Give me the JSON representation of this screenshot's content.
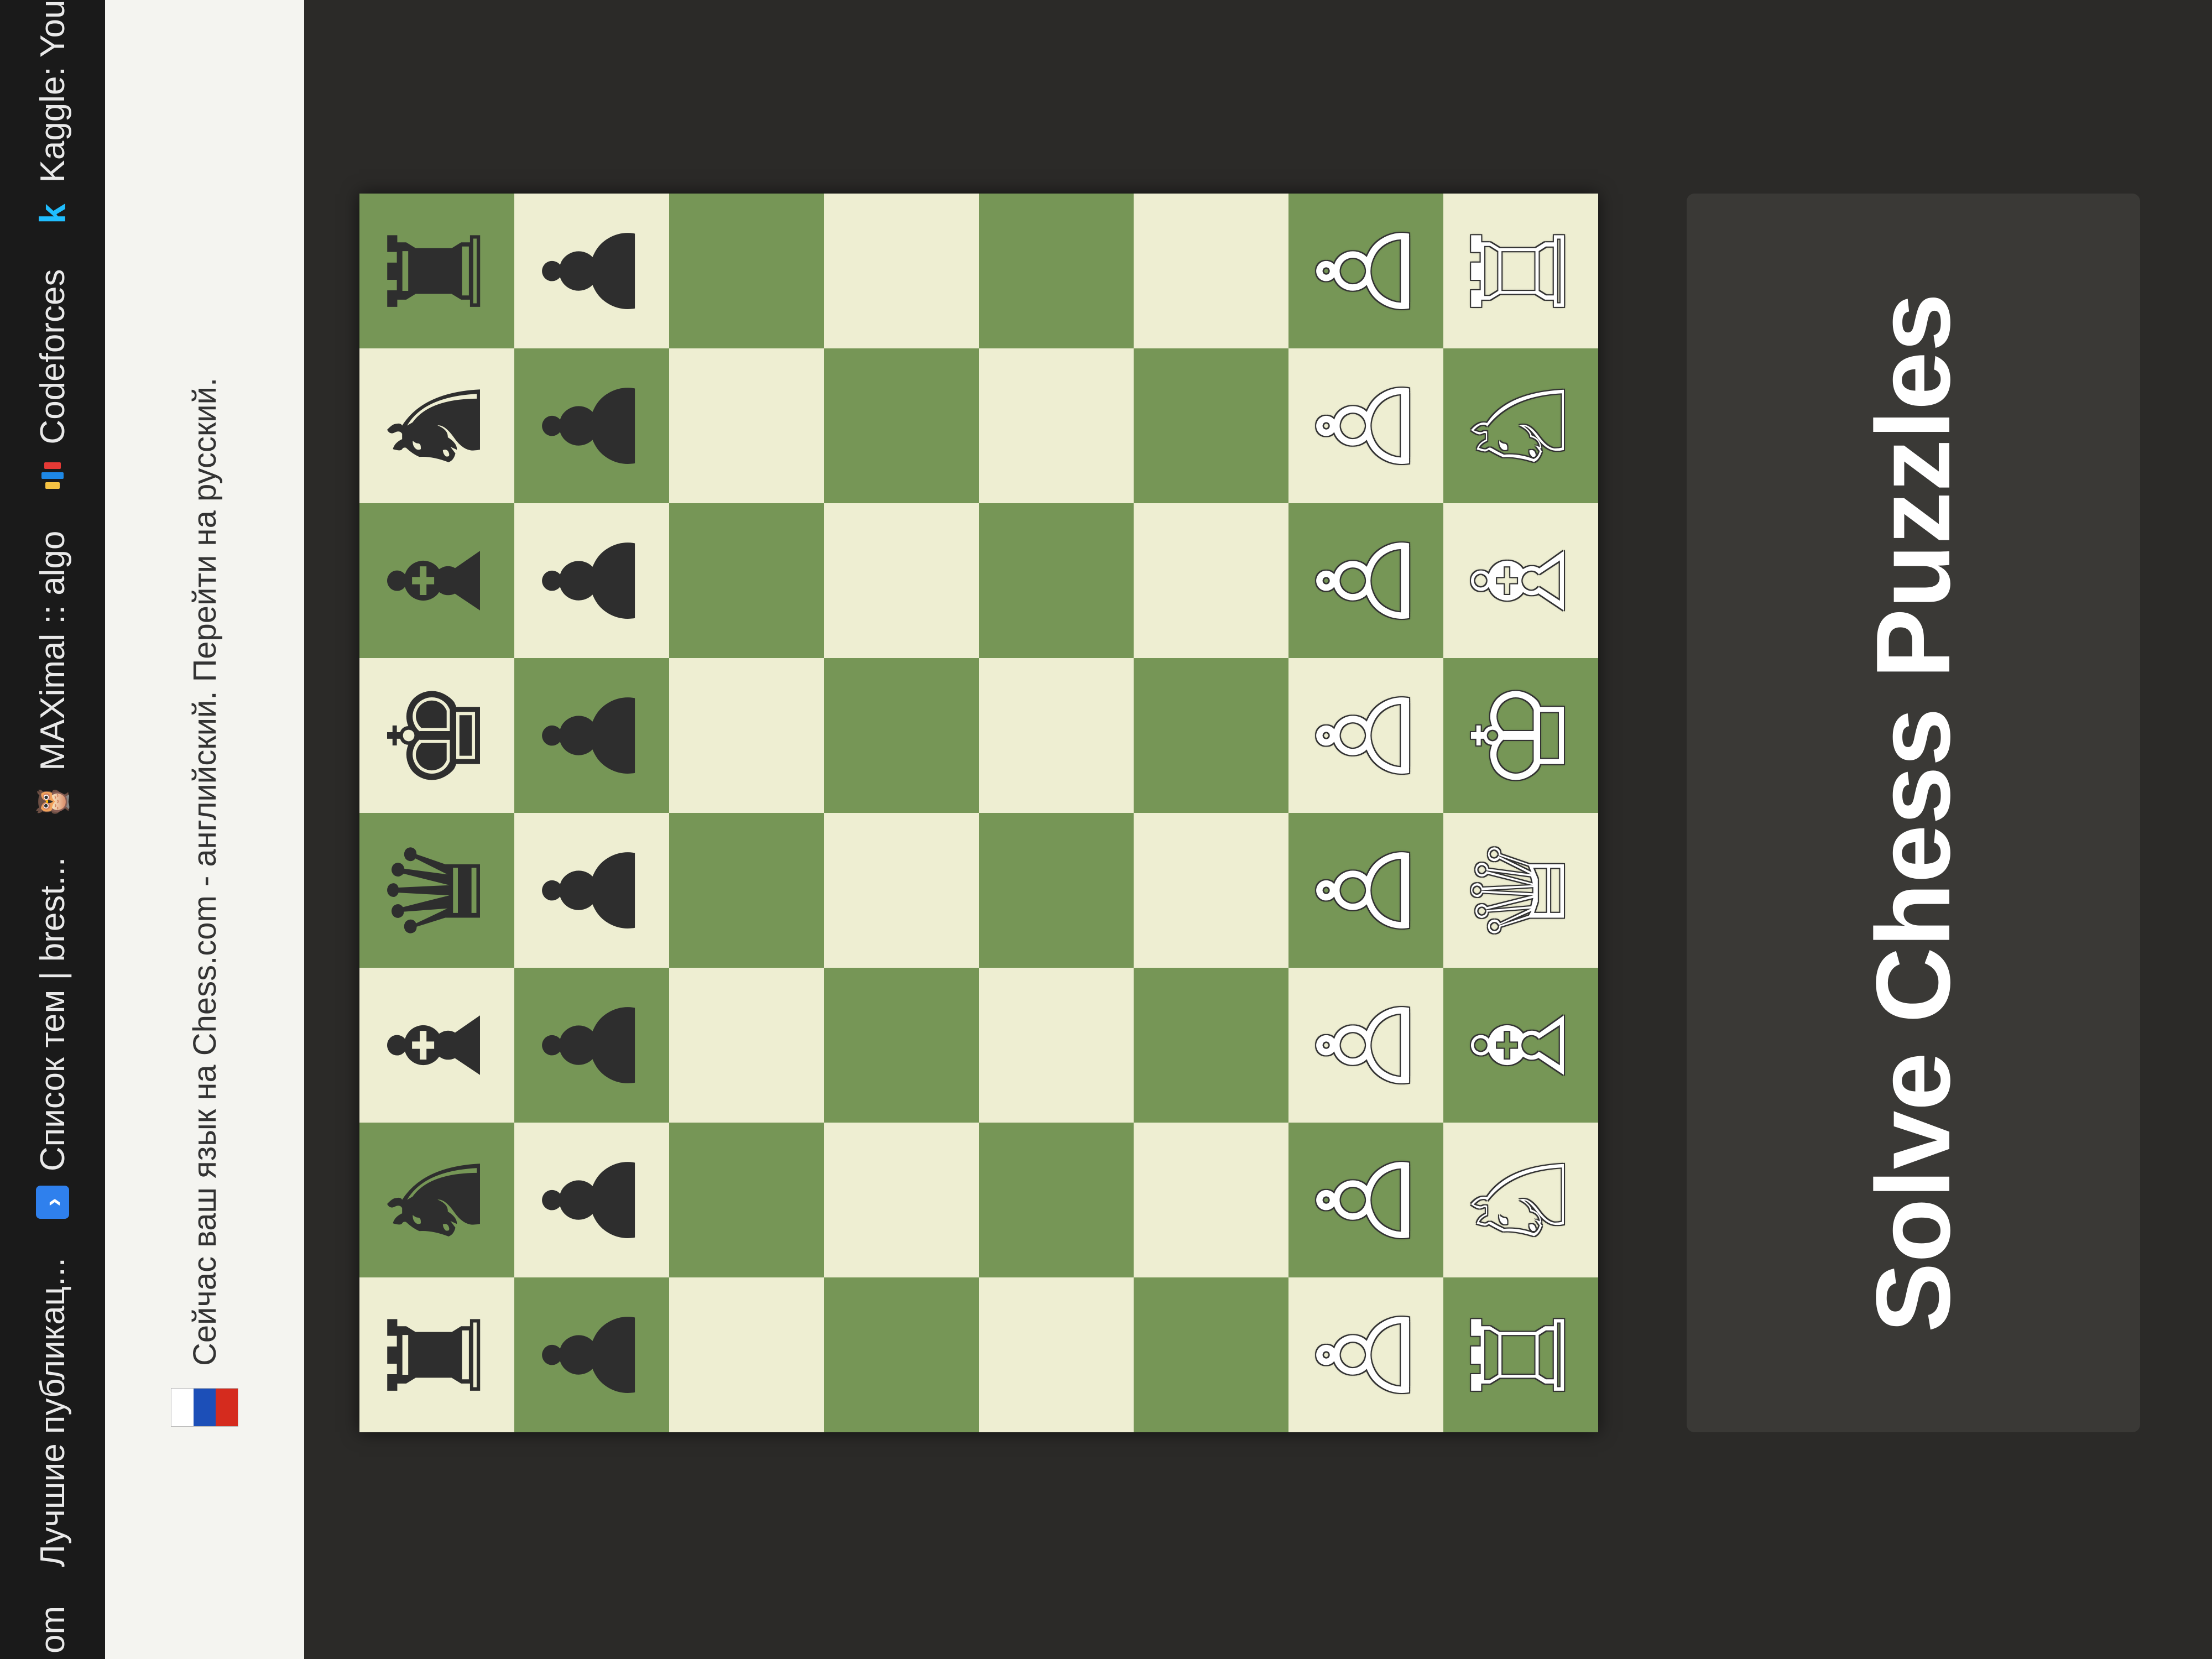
{
  "bookmarks": [
    {
      "label": "om",
      "icon": "none"
    },
    {
      "label": "Лучшие публикац...",
      "icon": "none"
    },
    {
      "label": "Список тем | brest...",
      "icon": "arrow-icon"
    },
    {
      "label": "MAXimal :: algo",
      "icon": "owl-icon"
    },
    {
      "label": "Codeforces",
      "icon": "codeforces-icon"
    },
    {
      "label": "Kaggle: Your Machi...",
      "icon": "kaggle-icon"
    }
  ],
  "language_banner": {
    "text": "Сейчас ваш язык на Chess.com - английский. Перейти на русский.",
    "flag_colors": [
      "#ffffff",
      "#1c4fb8",
      "#d52b1e"
    ]
  },
  "board": {
    "light_color": "#eeeed2",
    "dark_color": "#769656",
    "rows": [
      [
        "♜",
        "♞",
        "♝",
        "♛",
        "♚",
        "♝",
        "♞",
        "♜"
      ],
      [
        "♟",
        "♟",
        "♟",
        "♟",
        "♟",
        "♟",
        "♟",
        "♟"
      ],
      [
        "",
        "",
        "",
        "",
        "",
        "",
        "",
        ""
      ],
      [
        "",
        "",
        "",
        "",
        "",
        "",
        "",
        ""
      ],
      [
        "",
        "",
        "",
        "",
        "",
        "",
        "",
        ""
      ],
      [
        "",
        "",
        "",
        "",
        "",
        "",
        "",
        ""
      ],
      [
        "♙",
        "♙",
        "♙",
        "♙",
        "♙",
        "♙",
        "♙",
        "♙"
      ],
      [
        "♖",
        "♘",
        "♗",
        "♕",
        "♔",
        "♗",
        "♘",
        "♖"
      ]
    ]
  },
  "panel": {
    "title": "Solve Chess Puzzles"
  }
}
